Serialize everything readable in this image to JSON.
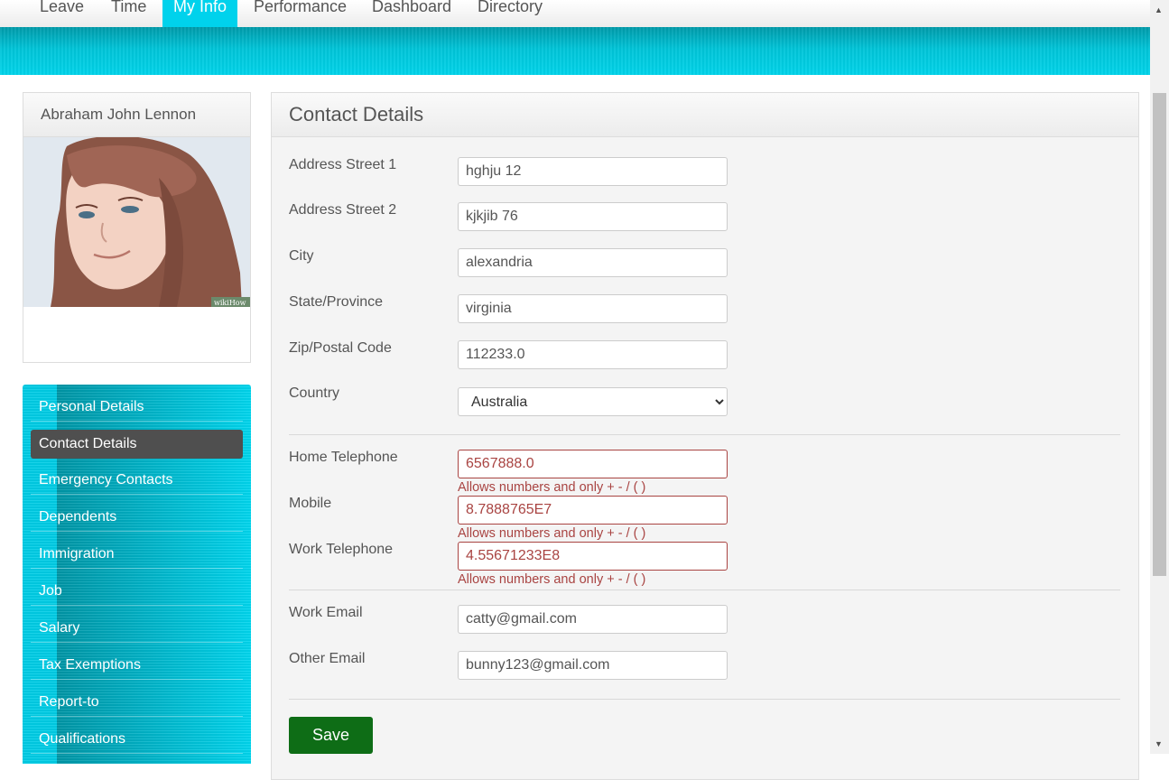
{
  "nav": {
    "tabs": [
      "Leave",
      "Time",
      "My Info",
      "Performance",
      "Dashboard",
      "Directory"
    ],
    "active": "My Info"
  },
  "profile": {
    "name": "Abraham John Lennon",
    "watermark": "wikiHow"
  },
  "sidebar": {
    "items": [
      "Personal Details",
      "Contact Details",
      "Emergency Contacts",
      "Dependents",
      "Immigration",
      "Job",
      "Salary",
      "Tax Exemptions",
      "Report-to",
      "Qualifications"
    ],
    "active": "Contact Details"
  },
  "form": {
    "title": "Contact Details",
    "address_street_1": {
      "label": "Address Street 1",
      "value": "hghju 12"
    },
    "address_street_2": {
      "label": "Address Street 2",
      "value": "kjkjib 76"
    },
    "city": {
      "label": "City",
      "value": "alexandria"
    },
    "state": {
      "label": "State/Province",
      "value": "virginia"
    },
    "zip": {
      "label": "Zip/Postal Code",
      "value": "112233.0"
    },
    "country": {
      "label": "Country",
      "value": "Australia"
    },
    "home_phone": {
      "label": "Home Telephone",
      "value": "6567888.0",
      "error": "Allows numbers and only + - / ( )"
    },
    "mobile": {
      "label": "Mobile",
      "value": "8.7888765E7",
      "error": "Allows numbers and only + - / ( )"
    },
    "work_phone": {
      "label": "Work Telephone",
      "value": "4.55671233E8",
      "error": "Allows numbers and only + - / ( )"
    },
    "work_email": {
      "label": "Work Email",
      "value": "catty@gmail.com"
    },
    "other_email": {
      "label": "Other Email",
      "value": "bunny123@gmail.com"
    },
    "save_label": "Save"
  },
  "colors": {
    "accent": "#00d2ec",
    "error": "#a94442",
    "save_button": "#0e6d16",
    "active_menu": "#4f4f4f"
  }
}
